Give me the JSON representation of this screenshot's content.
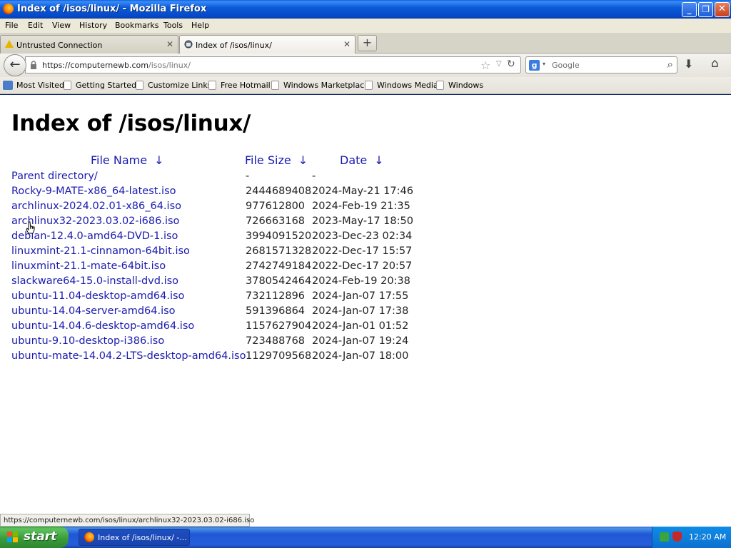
{
  "window": {
    "title": "Index of /isos/linux/ - Mozilla Firefox",
    "min": "_",
    "max": "❐",
    "close": "✕"
  },
  "menu": [
    "File",
    "Edit",
    "View",
    "History",
    "Bookmarks",
    "Tools",
    "Help"
  ],
  "tabs": [
    {
      "label": "Untrusted Connection",
      "icon": "warning-icon"
    },
    {
      "label": "Index of /isos/linux/",
      "icon": "page-icon"
    }
  ],
  "tab_close": "✕",
  "new_tab": "+",
  "nav": {
    "url_host": "https://computernewb.com",
    "url_path": "/isos/linux/",
    "search_placeholder": "Google",
    "back": "←",
    "star": "☆",
    "reload": "↻",
    "dropdown": "▽",
    "search_engine_dropdown": "▾",
    "search": "⌕",
    "download": "⬇",
    "home": "⌂",
    "google_badge": "g"
  },
  "bookmarks": [
    "Most Visited",
    "Getting Started",
    "Customize Links",
    "Free Hotmail",
    "Windows Marketplace",
    "Windows Media",
    "Windows"
  ],
  "page": {
    "heading": "Index of /isos/linux/",
    "columns": {
      "name": "File Name",
      "size": "File Size",
      "date": "Date",
      "sort_arrow": "↓"
    },
    "parent": {
      "name": "Parent directory/",
      "size": "-",
      "date": "-"
    },
    "rows": [
      {
        "name": "Rocky-9-MATE-x86_64-latest.iso",
        "size": "2444689408",
        "date": "2024-May-21 17:46"
      },
      {
        "name": "archlinux-2024.02.01-x86_64.iso",
        "size": "977612800",
        "date": "2024-Feb-19 21:35"
      },
      {
        "name": "archlinux32-2023.03.02-i686.iso",
        "size": "726663168",
        "date": "2023-May-17 18:50"
      },
      {
        "name": "debian-12.4.0-amd64-DVD-1.iso",
        "size": "3994091520",
        "date": "2023-Dec-23 02:34"
      },
      {
        "name": "linuxmint-21.1-cinnamon-64bit.iso",
        "size": "2681571328",
        "date": "2022-Dec-17 15:57"
      },
      {
        "name": "linuxmint-21.1-mate-64bit.iso",
        "size": "2742749184",
        "date": "2022-Dec-17 20:57"
      },
      {
        "name": "slackware64-15.0-install-dvd.iso",
        "size": "3780542464",
        "date": "2024-Feb-19 20:38"
      },
      {
        "name": "ubuntu-11.04-desktop-amd64.iso",
        "size": "732112896",
        "date": "2024-Jan-07 17:55"
      },
      {
        "name": "ubuntu-14.04-server-amd64.iso",
        "size": "591396864",
        "date": "2024-Jan-07 17:38"
      },
      {
        "name": "ubuntu-14.04.6-desktop-amd64.iso",
        "size": "1157627904",
        "date": "2024-Jan-01 01:52"
      },
      {
        "name": "ubuntu-9.10-desktop-i386.iso",
        "size": "723488768",
        "date": "2024-Jan-07 19:24"
      },
      {
        "name": "ubuntu-mate-14.04.2-LTS-desktop-amd64.iso",
        "size": "1129709568",
        "date": "2024-Jan-07 18:00"
      }
    ]
  },
  "status_url": "https://computernewb.com/isos/linux/archlinux32-2023.03.02-i686.iso",
  "taskbar": {
    "start": "start",
    "item": "Index of /isos/linux/ -...",
    "clock": "12:20 AM"
  },
  "colors": {
    "link": "#1a1ab0",
    "titlebar": "#0b5bd9",
    "start": "#3a9c3a"
  }
}
